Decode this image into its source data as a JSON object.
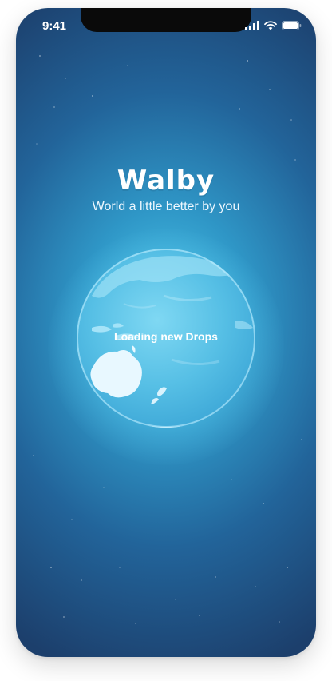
{
  "status_bar": {
    "time": "9:41",
    "icons": [
      "cellular-signal-icon",
      "wifi-icon",
      "battery-icon"
    ]
  },
  "app": {
    "title": "Walby",
    "subtitle": "World a little better by you",
    "loading_text": "Loading new Drops"
  },
  "colors": {
    "background_center": "#4ec9ec",
    "background_edge": "#1c3f6c",
    "text": "#ffffff"
  }
}
